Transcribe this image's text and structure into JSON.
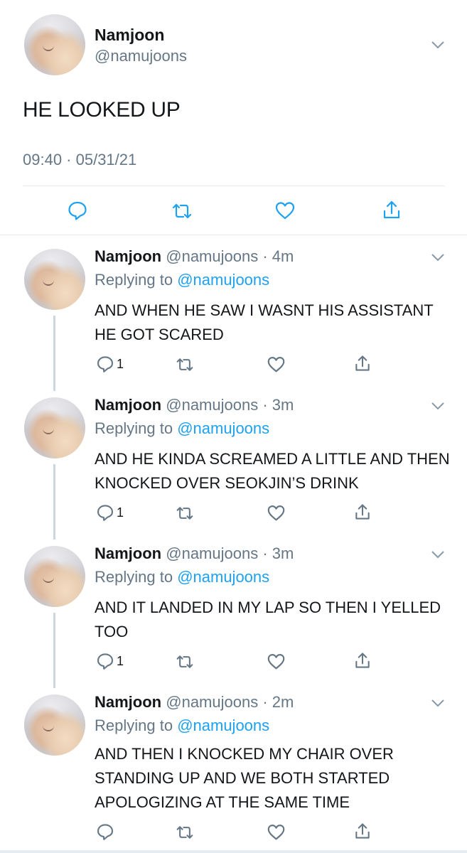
{
  "main_tweet": {
    "name": "Namjoon",
    "handle": "@namujoons",
    "text": "HE LOOKED UP",
    "timestamp": "09:40 · 05/31/21"
  },
  "replies": [
    {
      "name": "Namjoon",
      "handle": "@namujoons",
      "time": "4m",
      "replying_prefix": "Replying to ",
      "replying_to": "@namujoons",
      "text": "AND WHEN HE SAW I WASNT HIS ASSISTANT HE GOT SCARED",
      "reply_count": "1"
    },
    {
      "name": "Namjoon",
      "handle": "@namujoons",
      "time": "3m",
      "replying_prefix": "Replying to ",
      "replying_to": "@namujoons",
      "text": "AND HE KINDA SCREAMED A LITTLE AND THEN KNOCKED OVER SEOKJIN’S DRINK",
      "reply_count": "1"
    },
    {
      "name": "Namjoon",
      "handle": "@namujoons",
      "time": "3m",
      "replying_prefix": "Replying to ",
      "replying_to": "@namujoons",
      "text": "AND IT LANDED IN MY LAP SO THEN I YELLED TOO",
      "reply_count": "1"
    },
    {
      "name": "Namjoon",
      "handle": "@namujoons",
      "time": "2m",
      "replying_prefix": "Replying to ",
      "replying_to": "@namujoons",
      "text": "AND THEN I KNOCKED MY CHAIR OVER STANDING UP AND WE BOTH STARTED APOLOGIZING AT THE SAME TIME",
      "reply_count": ""
    }
  ],
  "separator": " · ",
  "colors": {
    "text": "#14171a",
    "secondary": "#657786",
    "link": "#1da1f2",
    "divider": "#e6ecf0",
    "thread_line": "#ccd6dd"
  },
  "icons": [
    "chevron-down-icon",
    "reply-icon",
    "retweet-icon",
    "like-icon",
    "share-icon"
  ]
}
